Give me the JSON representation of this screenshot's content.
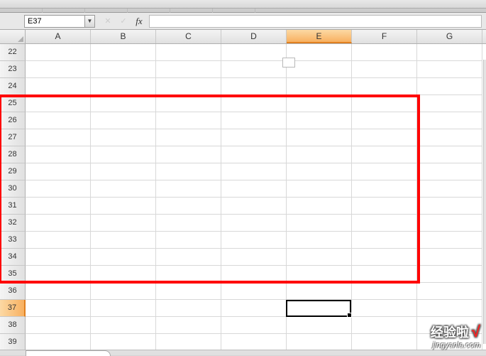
{
  "namebox": {
    "value": "E37"
  },
  "formula_bar": {
    "fx_label": "fx",
    "value": ""
  },
  "columns": [
    "A",
    "B",
    "C",
    "D",
    "E",
    "F",
    "G"
  ],
  "rows": [
    "22",
    "23",
    "24",
    "25",
    "26",
    "27",
    "28",
    "29",
    "30",
    "31",
    "32",
    "33",
    "34",
    "35",
    "36",
    "37",
    "38",
    "39"
  ],
  "active": {
    "col": "E",
    "row": "37",
    "col_index": 4,
    "row_index": 15
  },
  "watermark": {
    "title": "经验啦",
    "check": "√",
    "url": "jingyanla.com"
  },
  "annotation": {
    "red_rect": {
      "approx_cols": "A-F",
      "approx_rows": "25-35"
    }
  }
}
